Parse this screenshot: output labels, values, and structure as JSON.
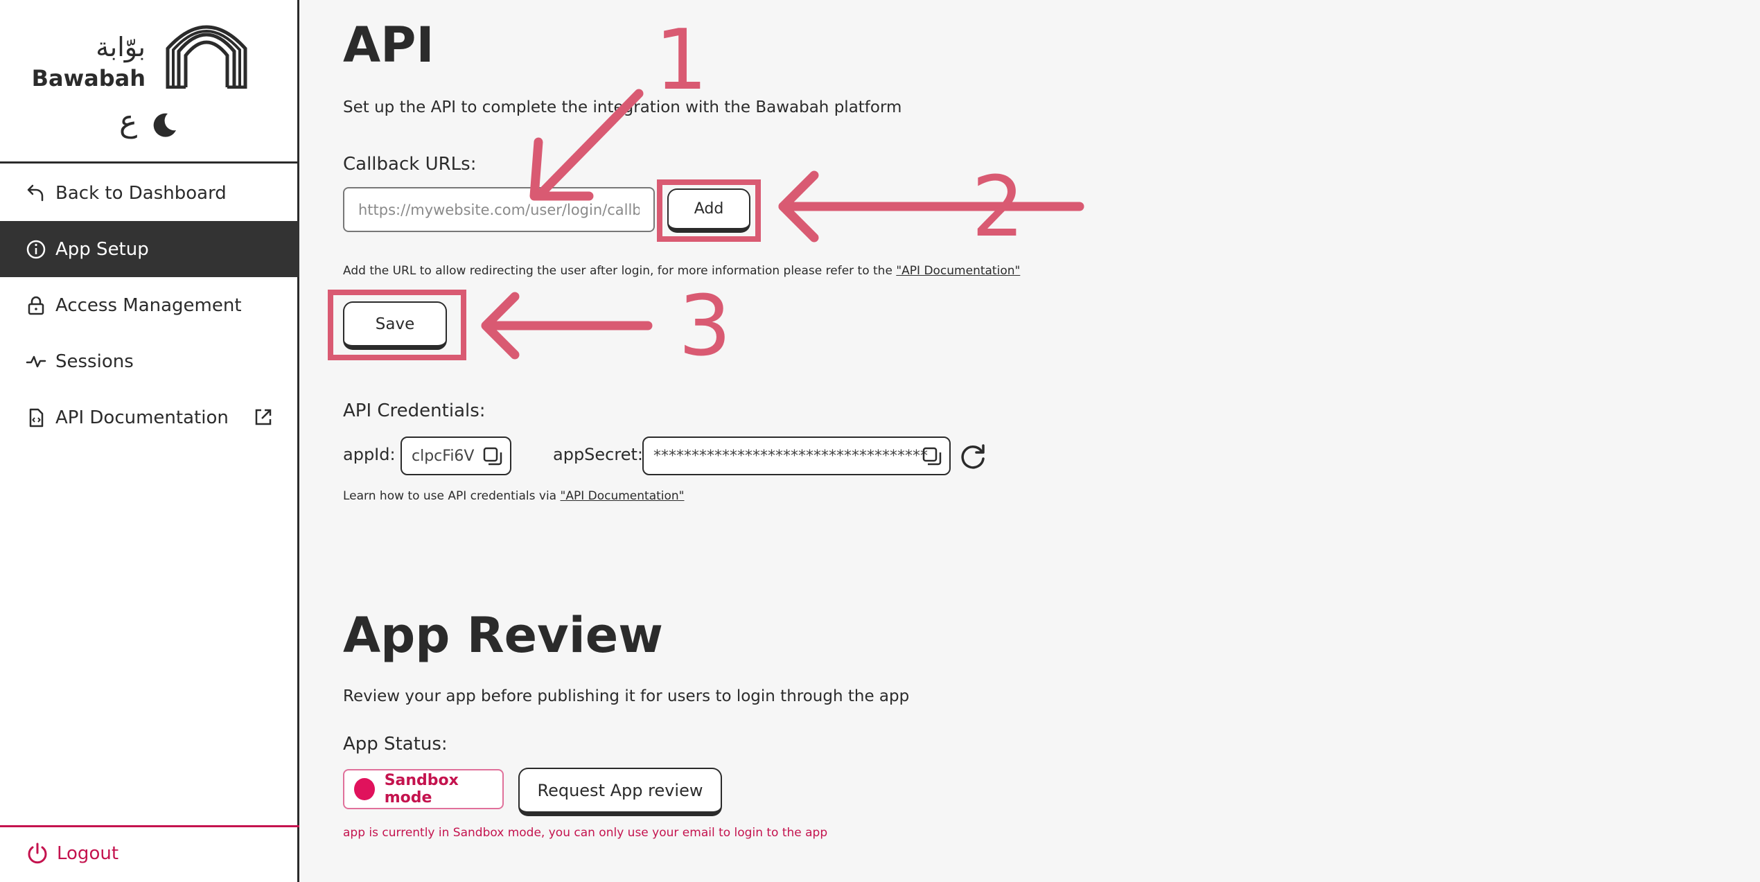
{
  "brand": {
    "arabic_name": "بوّابة",
    "name": "Bawabah",
    "lang_toggle": "ع"
  },
  "sidebar": {
    "items": [
      {
        "label": "Back to Dashboard",
        "icon": "back-arrow-icon"
      },
      {
        "label": "App Setup",
        "icon": "info-icon",
        "active": true
      },
      {
        "label": "Access Management",
        "icon": "lock-icon"
      },
      {
        "label": "Sessions",
        "icon": "activity-icon"
      },
      {
        "label": "API Documentation",
        "icon": "code-file-icon",
        "external": true
      }
    ],
    "logout": "Logout"
  },
  "api": {
    "title": "API",
    "description": "Set up the API to complete the integration with the Bawabah platform",
    "callback_label": "Callback URLs:",
    "callback_placeholder": "https://mywebsite.com/user/login/callback",
    "add_label": "Add",
    "help_prefix": "Add the URL to allow redirecting the user after login, for more information please refer to the ",
    "help_link": "\"API Documentation\"",
    "save_label": "Save",
    "credentials_label": "API Credentials:",
    "app_id_label": "appId:",
    "app_id_value": "clpcFi6V",
    "app_secret_label": "appSecret:",
    "app_secret_value": "************************************",
    "cred_help_prefix": "Learn how to use API credentials via ",
    "cred_help_link": "\"API Documentation\""
  },
  "review": {
    "title": "App Review",
    "description": "Review your app before publishing it for users to login through the app",
    "status_label": "App Status:",
    "status_value": "Sandbox mode",
    "request_label": "Request App review",
    "note": "app is currently in Sandbox mode, you can only use your email to login to the app"
  },
  "annotations": {
    "one": "1",
    "two": "2",
    "three": "3",
    "color": "#d95a72"
  },
  "colors": {
    "accent": "#c4134e",
    "dark": "#333333",
    "background": "#f6f6f6"
  }
}
